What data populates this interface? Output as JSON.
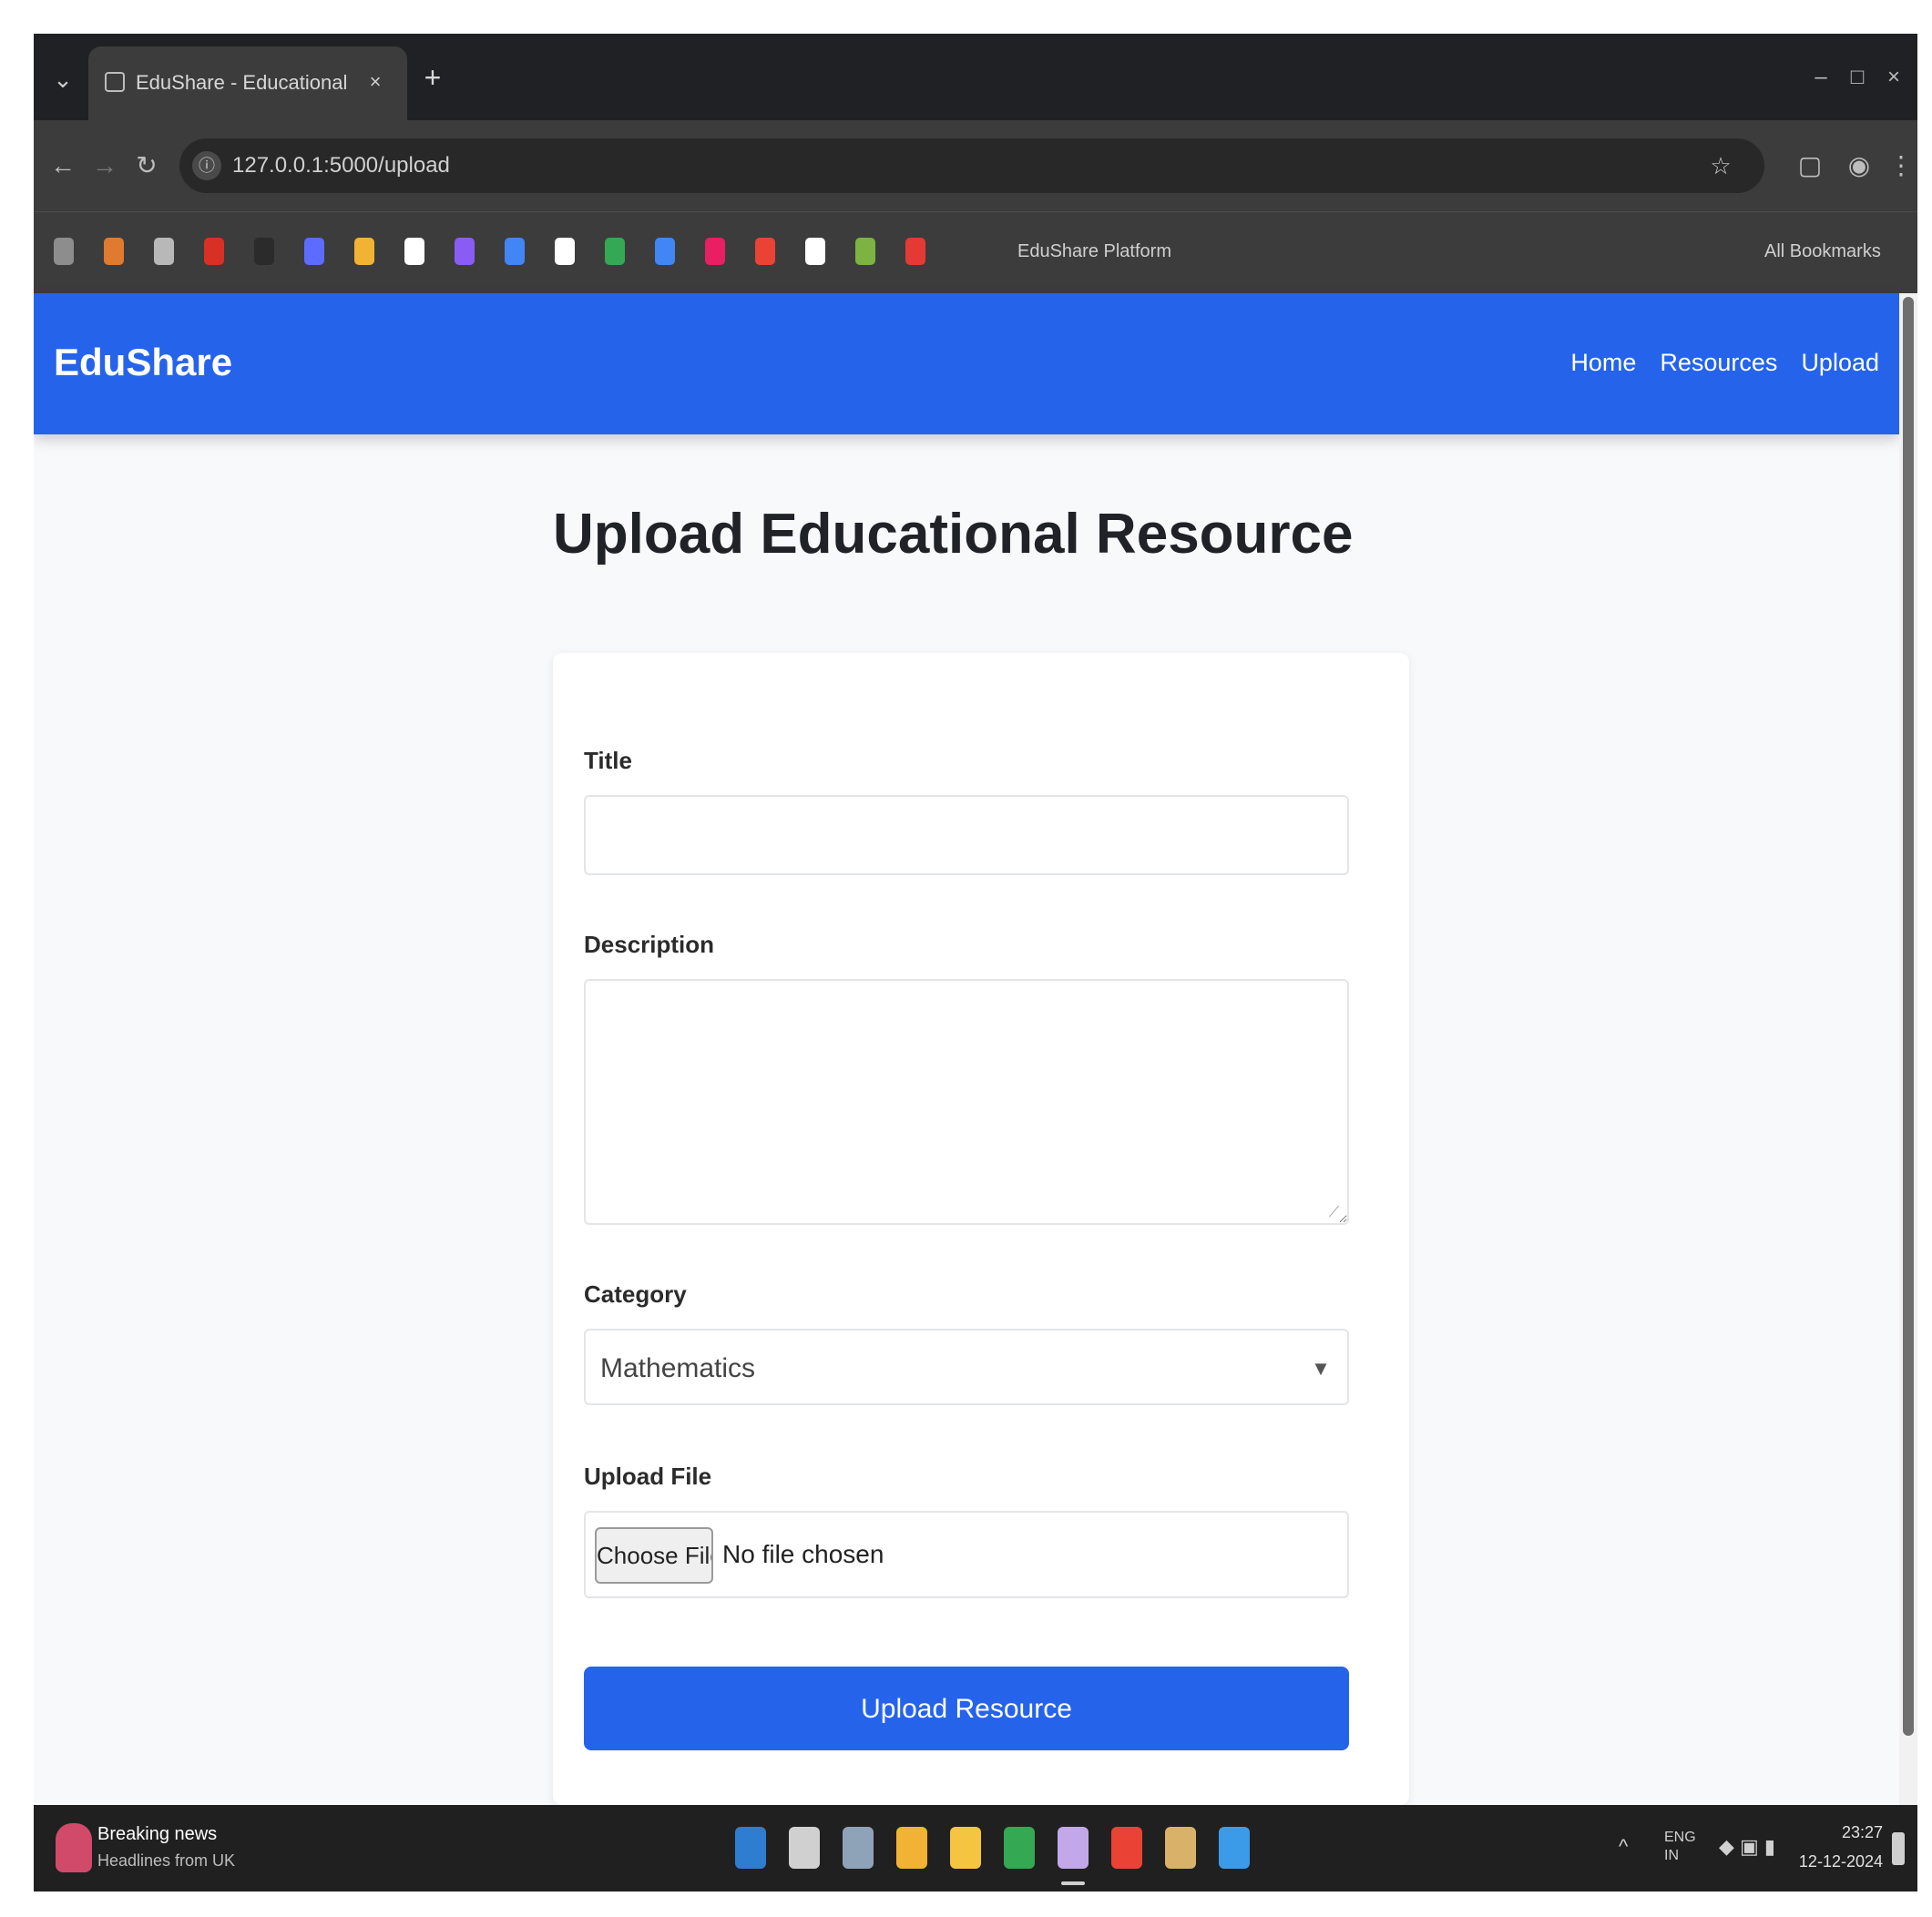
{
  "browser": {
    "tab_title": "EduShare - Educational Resource Platform",
    "tab_close": "×",
    "new_tab": "+",
    "window_controls": [
      "–",
      "□",
      "×"
    ],
    "address": "127.0.0.1:5000/upload",
    "star": "☆",
    "bookmark_label": "EduShare Platform",
    "all_bookmarks": "All Bookmarks",
    "icon_names": [
      "back-icon",
      "forward-icon",
      "reload-icon",
      "site-info-icon",
      "star-icon",
      "extensions-icon",
      "profile-icon",
      "menu-icon"
    ],
    "bookmark_colors": [
      "#8d8d8d",
      "#e07a2f",
      "#b8b8b8",
      "#d93025",
      "#2b2b2b",
      "#5b6cff",
      "#f2b233",
      "#ffffff",
      "#8a5cf6",
      "#4285f4",
      "#ffffff",
      "#34a853",
      "#4285f4",
      "#e91e63",
      "#ea4335",
      "#ffffff",
      "#7cb342",
      "#e53935"
    ]
  },
  "navbar": {
    "brand": "EduShare",
    "links": [
      "Home",
      "Resources",
      "Upload"
    ],
    "color": "#2563eb"
  },
  "main": {
    "title": "Upload Educational Resource",
    "form": {
      "title_label": "Title",
      "title_value": "",
      "description_label": "Description",
      "description_value": "",
      "category_label": "Category",
      "category_value": "Mathematics",
      "file_label": "Upload File",
      "file_button": "Choose File",
      "file_status": "No file chosen",
      "submit_label": "Upload Resource"
    }
  },
  "taskbar": {
    "weather_title": "Breaking news",
    "weather_sub": "Headlines from UK",
    "app_colors": [
      "#2f7dd1",
      "#d0d0d0",
      "#8fa3b8",
      "#f2b233",
      "#f5c542",
      "#34a853",
      "#c2a8e8",
      "#ea4335",
      "#d9b26a",
      "#3c9be8"
    ],
    "tray_text": "^",
    "tray_lang": "ENG\nIN",
    "clock_time": "23:27",
    "clock_date": "12-12-2024"
  }
}
